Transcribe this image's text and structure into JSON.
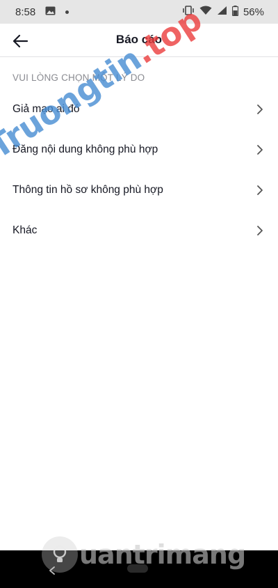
{
  "status_bar": {
    "time": "8:58",
    "battery": "56%",
    "icons": [
      "image-icon",
      "vibrate-icon",
      "wifi-icon",
      "signal-icon",
      "battery-icon"
    ]
  },
  "header": {
    "title": "Báo cáo",
    "back_icon": "arrow-left-icon"
  },
  "section_label": "VUI LÒNG CHỌN MỘT LÝ DO",
  "reasons": [
    {
      "label": "Giả mạo ai đó"
    },
    {
      "label": "Đăng nội dung không phù hợp"
    },
    {
      "label": "Thông tin hồ sơ không phù hợp"
    },
    {
      "label": "Khác"
    }
  ],
  "watermark": {
    "part1": "Truongtin",
    "part2": ".top"
  },
  "logo_watermark": "uantrimang"
}
